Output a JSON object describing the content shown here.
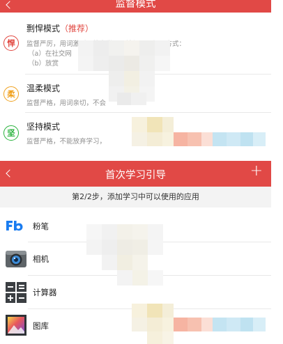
{
  "top_bar": {
    "title": "监督模式"
  },
  "modes": [
    {
      "icon_char": "悍",
      "color": "#e1463f",
      "title": "剽悍模式",
      "tag": "（推荐）",
      "desc": "监督严厉，用词激烈，放弃学习要被惩罚，惩罚方式：",
      "options": [
        "（a）在社交网",
        "（b）放赏"
      ]
    },
    {
      "icon_char": "柔",
      "color": "#f0a11e",
      "title": "温柔模式",
      "tag": "",
      "desc": "监督严格，用词亲切，不会",
      "options": []
    },
    {
      "icon_char": "坚",
      "color": "#27b23b",
      "title": "坚持模式",
      "tag": "",
      "desc": "监督严格，不能放弃学习，",
      "options": []
    }
  ],
  "guide_bar": {
    "title": "首次学习引导",
    "add_label": "+"
  },
  "step_text": "第2/2步，添加学习中可以使用的应用",
  "apps": [
    {
      "label": "粉笔",
      "icon": "fenbi-logo-icon"
    },
    {
      "label": "相机",
      "icon": "camera-icon"
    },
    {
      "label": "计算器",
      "icon": "calculator-icon"
    },
    {
      "label": "图库",
      "icon": "gallery-icon"
    }
  ]
}
